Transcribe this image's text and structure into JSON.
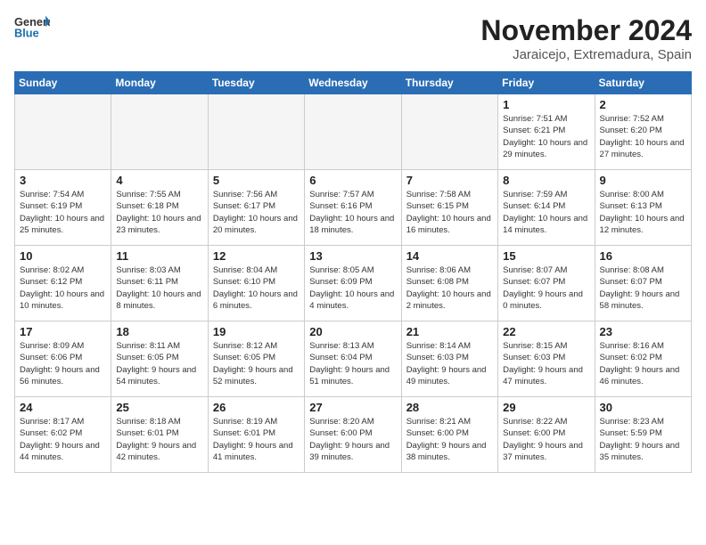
{
  "header": {
    "logo_general": "General",
    "logo_blue": "Blue",
    "month_title": "November 2024",
    "location": "Jaraicejo, Extremadura, Spain"
  },
  "weekdays": [
    "Sunday",
    "Monday",
    "Tuesday",
    "Wednesday",
    "Thursday",
    "Friday",
    "Saturday"
  ],
  "weeks": [
    [
      {
        "day": "",
        "info": ""
      },
      {
        "day": "",
        "info": ""
      },
      {
        "day": "",
        "info": ""
      },
      {
        "day": "",
        "info": ""
      },
      {
        "day": "",
        "info": ""
      },
      {
        "day": "1",
        "info": "Sunrise: 7:51 AM\nSunset: 6:21 PM\nDaylight: 10 hours and 29 minutes."
      },
      {
        "day": "2",
        "info": "Sunrise: 7:52 AM\nSunset: 6:20 PM\nDaylight: 10 hours and 27 minutes."
      }
    ],
    [
      {
        "day": "3",
        "info": "Sunrise: 7:54 AM\nSunset: 6:19 PM\nDaylight: 10 hours and 25 minutes."
      },
      {
        "day": "4",
        "info": "Sunrise: 7:55 AM\nSunset: 6:18 PM\nDaylight: 10 hours and 23 minutes."
      },
      {
        "day": "5",
        "info": "Sunrise: 7:56 AM\nSunset: 6:17 PM\nDaylight: 10 hours and 20 minutes."
      },
      {
        "day": "6",
        "info": "Sunrise: 7:57 AM\nSunset: 6:16 PM\nDaylight: 10 hours and 18 minutes."
      },
      {
        "day": "7",
        "info": "Sunrise: 7:58 AM\nSunset: 6:15 PM\nDaylight: 10 hours and 16 minutes."
      },
      {
        "day": "8",
        "info": "Sunrise: 7:59 AM\nSunset: 6:14 PM\nDaylight: 10 hours and 14 minutes."
      },
      {
        "day": "9",
        "info": "Sunrise: 8:00 AM\nSunset: 6:13 PM\nDaylight: 10 hours and 12 minutes."
      }
    ],
    [
      {
        "day": "10",
        "info": "Sunrise: 8:02 AM\nSunset: 6:12 PM\nDaylight: 10 hours and 10 minutes."
      },
      {
        "day": "11",
        "info": "Sunrise: 8:03 AM\nSunset: 6:11 PM\nDaylight: 10 hours and 8 minutes."
      },
      {
        "day": "12",
        "info": "Sunrise: 8:04 AM\nSunset: 6:10 PM\nDaylight: 10 hours and 6 minutes."
      },
      {
        "day": "13",
        "info": "Sunrise: 8:05 AM\nSunset: 6:09 PM\nDaylight: 10 hours and 4 minutes."
      },
      {
        "day": "14",
        "info": "Sunrise: 8:06 AM\nSunset: 6:08 PM\nDaylight: 10 hours and 2 minutes."
      },
      {
        "day": "15",
        "info": "Sunrise: 8:07 AM\nSunset: 6:07 PM\nDaylight: 9 hours and 0 minutes."
      },
      {
        "day": "16",
        "info": "Sunrise: 8:08 AM\nSunset: 6:07 PM\nDaylight: 9 hours and 58 minutes."
      }
    ],
    [
      {
        "day": "17",
        "info": "Sunrise: 8:09 AM\nSunset: 6:06 PM\nDaylight: 9 hours and 56 minutes."
      },
      {
        "day": "18",
        "info": "Sunrise: 8:11 AM\nSunset: 6:05 PM\nDaylight: 9 hours and 54 minutes."
      },
      {
        "day": "19",
        "info": "Sunrise: 8:12 AM\nSunset: 6:05 PM\nDaylight: 9 hours and 52 minutes."
      },
      {
        "day": "20",
        "info": "Sunrise: 8:13 AM\nSunset: 6:04 PM\nDaylight: 9 hours and 51 minutes."
      },
      {
        "day": "21",
        "info": "Sunrise: 8:14 AM\nSunset: 6:03 PM\nDaylight: 9 hours and 49 minutes."
      },
      {
        "day": "22",
        "info": "Sunrise: 8:15 AM\nSunset: 6:03 PM\nDaylight: 9 hours and 47 minutes."
      },
      {
        "day": "23",
        "info": "Sunrise: 8:16 AM\nSunset: 6:02 PM\nDaylight: 9 hours and 46 minutes."
      }
    ],
    [
      {
        "day": "24",
        "info": "Sunrise: 8:17 AM\nSunset: 6:02 PM\nDaylight: 9 hours and 44 minutes."
      },
      {
        "day": "25",
        "info": "Sunrise: 8:18 AM\nSunset: 6:01 PM\nDaylight: 9 hours and 42 minutes."
      },
      {
        "day": "26",
        "info": "Sunrise: 8:19 AM\nSunset: 6:01 PM\nDaylight: 9 hours and 41 minutes."
      },
      {
        "day": "27",
        "info": "Sunrise: 8:20 AM\nSunset: 6:00 PM\nDaylight: 9 hours and 39 minutes."
      },
      {
        "day": "28",
        "info": "Sunrise: 8:21 AM\nSunset: 6:00 PM\nDaylight: 9 hours and 38 minutes."
      },
      {
        "day": "29",
        "info": "Sunrise: 8:22 AM\nSunset: 6:00 PM\nDaylight: 9 hours and 37 minutes."
      },
      {
        "day": "30",
        "info": "Sunrise: 8:23 AM\nSunset: 5:59 PM\nDaylight: 9 hours and 35 minutes."
      }
    ]
  ]
}
